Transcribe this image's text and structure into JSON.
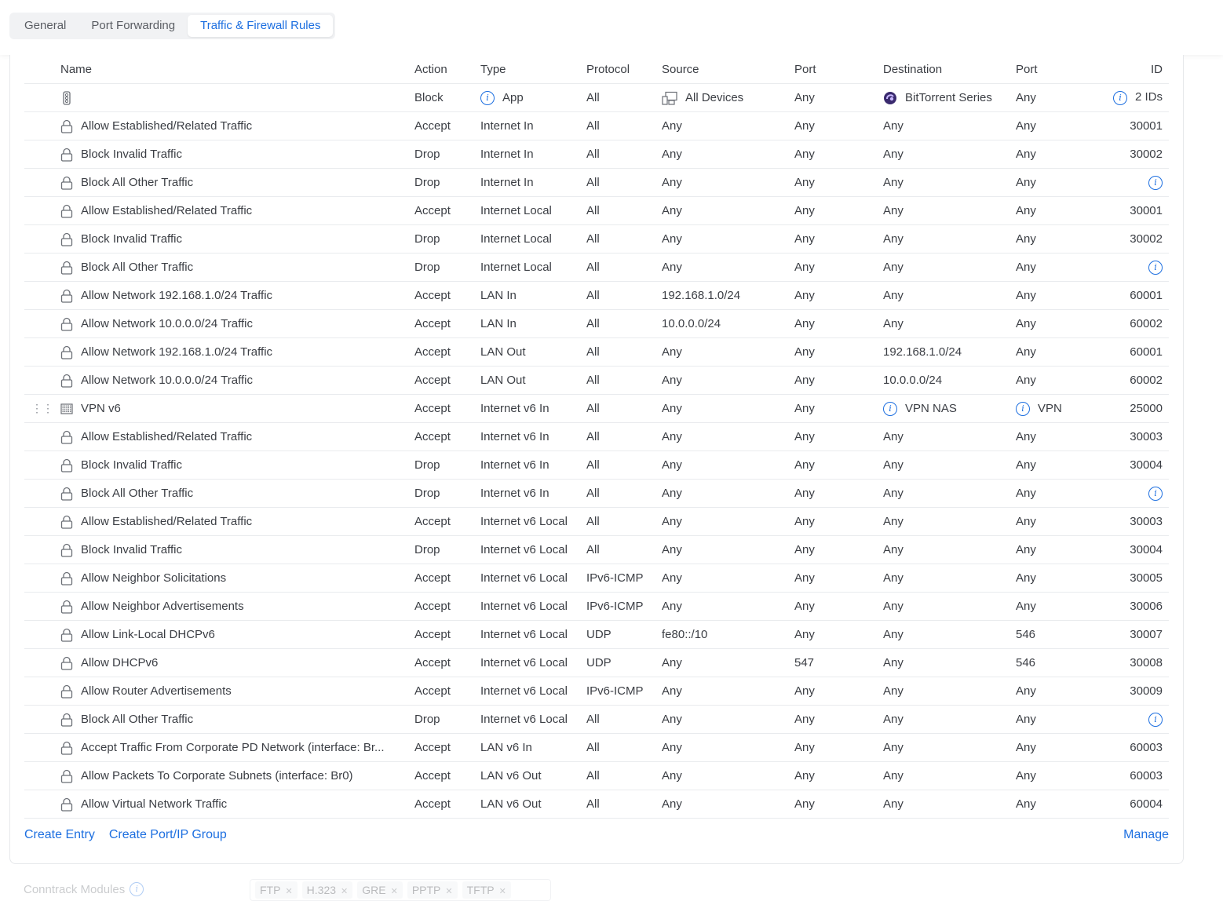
{
  "tabs": [
    "General",
    "Port Forwarding",
    "Traffic & Firewall Rules"
  ],
  "active_tab": 2,
  "columns": {
    "name": "Name",
    "action": "Action",
    "type": "Type",
    "protocol": "Protocol",
    "source": "Source",
    "src_port": "Port",
    "destination": "Destination",
    "dst_port": "Port",
    "id": "ID"
  },
  "rows": [
    {
      "icon": "traffic-light-icon",
      "name": "",
      "action": "Block",
      "type": "App",
      "type_info": true,
      "protocol": "All",
      "source": "All Devices",
      "source_icon": "devices-icon",
      "src_port": "Any",
      "destination": "BitTorrent Series",
      "dest_icon": "bittorrent-icon",
      "dst_port": "Any",
      "id": "2 IDs",
      "id_info": true
    },
    {
      "icon": "lock-icon",
      "name": "Allow Established/Related Traffic",
      "action": "Accept",
      "type": "Internet In",
      "protocol": "All",
      "source": "Any",
      "src_port": "Any",
      "destination": "Any",
      "dst_port": "Any",
      "id": "30001"
    },
    {
      "icon": "lock-icon",
      "name": "Block Invalid Traffic",
      "action": "Drop",
      "type": "Internet In",
      "protocol": "All",
      "source": "Any",
      "src_port": "Any",
      "destination": "Any",
      "dst_port": "Any",
      "id": "30002"
    },
    {
      "icon": "lock-icon",
      "name": "Block All Other Traffic",
      "action": "Drop",
      "type": "Internet In",
      "protocol": "All",
      "source": "Any",
      "src_port": "Any",
      "destination": "Any",
      "dst_port": "Any",
      "id": "",
      "id_info": true
    },
    {
      "icon": "lock-icon",
      "name": "Allow Established/Related Traffic",
      "action": "Accept",
      "type": "Internet Local",
      "protocol": "All",
      "source": "Any",
      "src_port": "Any",
      "destination": "Any",
      "dst_port": "Any",
      "id": "30001"
    },
    {
      "icon": "lock-icon",
      "name": "Block Invalid Traffic",
      "action": "Drop",
      "type": "Internet Local",
      "protocol": "All",
      "source": "Any",
      "src_port": "Any",
      "destination": "Any",
      "dst_port": "Any",
      "id": "30002"
    },
    {
      "icon": "lock-icon",
      "name": "Block All Other Traffic",
      "action": "Drop",
      "type": "Internet Local",
      "protocol": "All",
      "source": "Any",
      "src_port": "Any",
      "destination": "Any",
      "dst_port": "Any",
      "id": "",
      "id_info": true
    },
    {
      "icon": "lock-icon",
      "name": "Allow Network 192.168.1.0/24 Traffic",
      "action": "Accept",
      "type": "LAN In",
      "protocol": "All",
      "source": "192.168.1.0/24",
      "src_port": "Any",
      "destination": "Any",
      "dst_port": "Any",
      "id": "60001"
    },
    {
      "icon": "lock-icon",
      "name": "Allow Network 10.0.0.0/24 Traffic",
      "action": "Accept",
      "type": "LAN In",
      "protocol": "All",
      "source": "10.0.0.0/24",
      "src_port": "Any",
      "destination": "Any",
      "dst_port": "Any",
      "id": "60002"
    },
    {
      "icon": "lock-icon",
      "name": "Allow Network 192.168.1.0/24 Traffic",
      "action": "Accept",
      "type": "LAN Out",
      "protocol": "All",
      "source": "Any",
      "src_port": "Any",
      "destination": "192.168.1.0/24",
      "dst_port": "Any",
      "id": "60001"
    },
    {
      "icon": "lock-icon",
      "name": "Allow Network 10.0.0.0/24 Traffic",
      "action": "Accept",
      "type": "LAN Out",
      "protocol": "All",
      "source": "Any",
      "src_port": "Any",
      "destination": "10.0.0.0/24",
      "dst_port": "Any",
      "id": "60002"
    },
    {
      "icon": "grid-icon",
      "drag": true,
      "name": "VPN v6",
      "action": "Accept",
      "type": "Internet v6 In",
      "protocol": "All",
      "source": "Any",
      "src_port": "Any",
      "destination": "VPN NAS",
      "dest_info": true,
      "dst_port": "VPN",
      "dst_port_info": true,
      "id": "25000"
    },
    {
      "icon": "lock-icon",
      "name": "Allow Established/Related Traffic",
      "action": "Accept",
      "type": "Internet v6 In",
      "protocol": "All",
      "source": "Any",
      "src_port": "Any",
      "destination": "Any",
      "dst_port": "Any",
      "id": "30003"
    },
    {
      "icon": "lock-icon",
      "name": "Block Invalid Traffic",
      "action": "Drop",
      "type": "Internet v6 In",
      "protocol": "All",
      "source": "Any",
      "src_port": "Any",
      "destination": "Any",
      "dst_port": "Any",
      "id": "30004"
    },
    {
      "icon": "lock-icon",
      "name": "Block All Other Traffic",
      "action": "Drop",
      "type": "Internet v6 In",
      "protocol": "All",
      "source": "Any",
      "src_port": "Any",
      "destination": "Any",
      "dst_port": "Any",
      "id": "",
      "id_info": true
    },
    {
      "icon": "lock-icon",
      "name": "Allow Established/Related Traffic",
      "action": "Accept",
      "type": "Internet v6 Local",
      "protocol": "All",
      "source": "Any",
      "src_port": "Any",
      "destination": "Any",
      "dst_port": "Any",
      "id": "30003"
    },
    {
      "icon": "lock-icon",
      "name": "Block Invalid Traffic",
      "action": "Drop",
      "type": "Internet v6 Local",
      "protocol": "All",
      "source": "Any",
      "src_port": "Any",
      "destination": "Any",
      "dst_port": "Any",
      "id": "30004"
    },
    {
      "icon": "lock-icon",
      "name": "Allow Neighbor Solicitations",
      "action": "Accept",
      "type": "Internet v6 Local",
      "protocol": "IPv6-ICMP",
      "source": "Any",
      "src_port": "Any",
      "destination": "Any",
      "dst_port": "Any",
      "id": "30005"
    },
    {
      "icon": "lock-icon",
      "name": "Allow Neighbor Advertisements",
      "action": "Accept",
      "type": "Internet v6 Local",
      "protocol": "IPv6-ICMP",
      "source": "Any",
      "src_port": "Any",
      "destination": "Any",
      "dst_port": "Any",
      "id": "30006"
    },
    {
      "icon": "lock-icon",
      "name": "Allow Link-Local DHCPv6",
      "action": "Accept",
      "type": "Internet v6 Local",
      "protocol": "UDP",
      "source": "fe80::/10",
      "src_port": "Any",
      "destination": "Any",
      "dst_port": "546",
      "id": "30007"
    },
    {
      "icon": "lock-icon",
      "name": "Allow DHCPv6",
      "action": "Accept",
      "type": "Internet v6 Local",
      "protocol": "UDP",
      "source": "Any",
      "src_port": "547",
      "destination": "Any",
      "dst_port": "546",
      "id": "30008"
    },
    {
      "icon": "lock-icon",
      "name": "Allow Router Advertisements",
      "action": "Accept",
      "type": "Internet v6 Local",
      "protocol": "IPv6-ICMP",
      "source": "Any",
      "src_port": "Any",
      "destination": "Any",
      "dst_port": "Any",
      "id": "30009"
    },
    {
      "icon": "lock-icon",
      "name": "Block All Other Traffic",
      "action": "Drop",
      "type": "Internet v6 Local",
      "protocol": "All",
      "source": "Any",
      "src_port": "Any",
      "destination": "Any",
      "dst_port": "Any",
      "id": "",
      "id_info": true
    },
    {
      "icon": "lock-icon",
      "name": "Accept Traffic From Corporate PD Network (interface: Br...",
      "action": "Accept",
      "type": "LAN v6 In",
      "protocol": "All",
      "source": "Any",
      "src_port": "Any",
      "destination": "Any",
      "dst_port": "Any",
      "id": "60003"
    },
    {
      "icon": "lock-icon",
      "name": "Allow Packets To Corporate Subnets (interface: Br0)",
      "action": "Accept",
      "type": "LAN v6 Out",
      "protocol": "All",
      "source": "Any",
      "src_port": "Any",
      "destination": "Any",
      "dst_port": "Any",
      "id": "60003"
    },
    {
      "icon": "lock-icon",
      "name": "Allow Virtual Network Traffic",
      "action": "Accept",
      "type": "LAN v6 Out",
      "protocol": "All",
      "source": "Any",
      "src_port": "Any",
      "destination": "Any",
      "dst_port": "Any",
      "id": "60004"
    }
  ],
  "footer": {
    "create_entry": "Create Entry",
    "create_group": "Create Port/IP Group",
    "manage": "Manage"
  },
  "conntrack": {
    "label": "Conntrack Modules",
    "chips": [
      "FTP",
      "H.323",
      "GRE",
      "PPTP",
      "TFTP"
    ]
  },
  "colors": {
    "accent": "#1d6fe0",
    "text": "#3b3e44",
    "border": "#e9ebee"
  }
}
